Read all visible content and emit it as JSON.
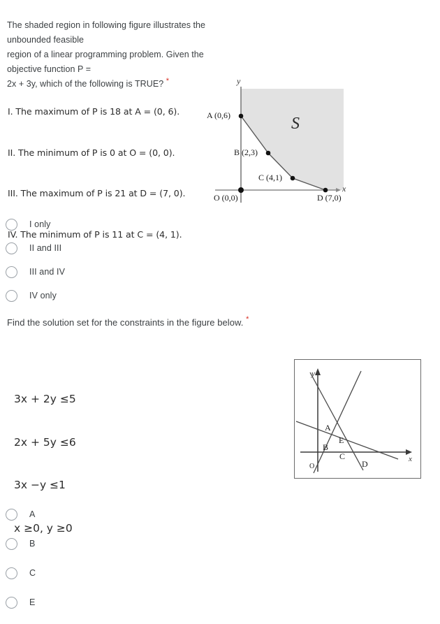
{
  "question1": {
    "prompt_lines": [
      "The shaded region in following figure illustrates the unbounded feasible",
      "region of a linear programming problem. Given the objective function P =",
      "2x + 3y, which of the following is TRUE?"
    ],
    "required_marker": "*",
    "statements": [
      "I. The maximum of P is 18 at A = (0, 6).",
      "II. The minimum of P is 0 at O = (0, 0).",
      "III. The maximum of P is 21 at D = (7, 0).",
      "IV. The minimum of P is 11 at C = (4, 1)."
    ],
    "options": [
      {
        "label": "I only",
        "selected": false
      },
      {
        "label": "II and III",
        "selected": false
      },
      {
        "label": "III and IV",
        "selected": false
      },
      {
        "label": "IV only",
        "selected": false
      }
    ],
    "figure": {
      "region_label": "S",
      "axis_x_label": "x",
      "axis_y_label": "y",
      "points": [
        {
          "name": "A",
          "coords": "(0,6)",
          "label": "A  (0,6)"
        },
        {
          "name": "B",
          "coords": "(2,3)",
          "label": "B  (2,3)"
        },
        {
          "name": "C",
          "coords": "(4,1)",
          "label": "C  (4,1)"
        },
        {
          "name": "D",
          "coords": "(7,0)",
          "label": "D  (7,0)"
        },
        {
          "name": "O",
          "coords": "(0,0)",
          "label": "O  (0,0)"
        }
      ],
      "shade_color": "#e2e2e2",
      "line_color": "#5a5a5a"
    }
  },
  "question2": {
    "prompt": "Find the solution set for the constraints in the figure below.",
    "required_marker": "*",
    "constraints": [
      "3x + 2y ≤5",
      "2x + 5y ≤6",
      "3x −y ≤1",
      "x ≥0, y ≥0"
    ],
    "options": [
      {
        "label": "A",
        "selected": false
      },
      {
        "label": "B",
        "selected": false
      },
      {
        "label": "C",
        "selected": false
      },
      {
        "label": "E",
        "selected": false
      }
    ],
    "figure": {
      "axis_x_label": "x",
      "axis_y_label": "y",
      "origin_label": "O",
      "region_labels": [
        "A",
        "B",
        "C",
        "D",
        "E"
      ],
      "line_color": "#4a4a4a",
      "border_color": "#6b6b6b"
    }
  }
}
